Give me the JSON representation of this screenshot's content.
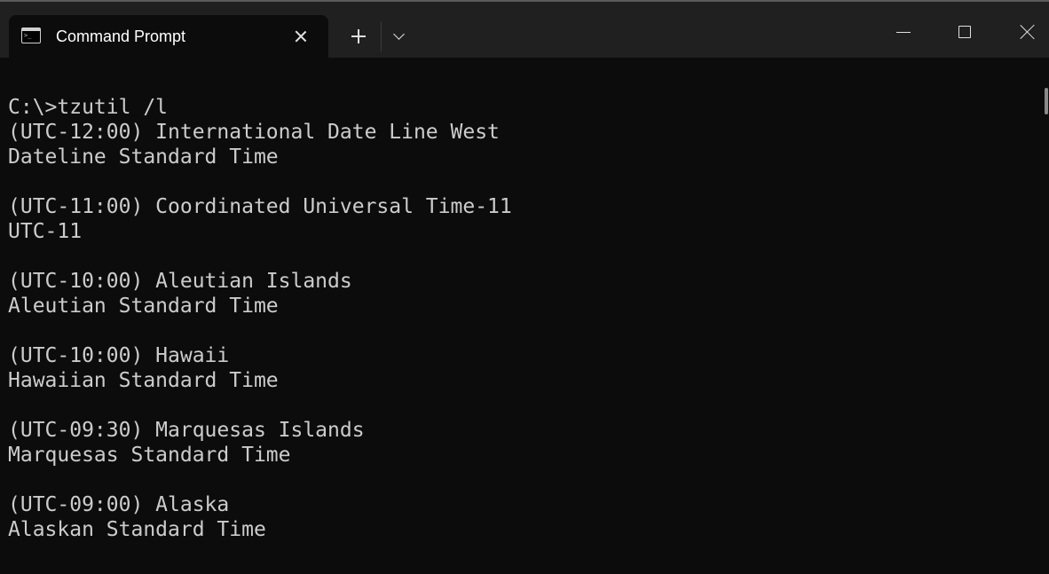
{
  "window": {
    "tab_title": "Command Prompt",
    "tab_icon": "terminal-icon",
    "tab_icon_glyph": ">_",
    "controls": {
      "close_tab": "close-icon",
      "new_tab": "plus-icon",
      "dropdown": "chevron-down-icon",
      "minimize": "minimize-icon",
      "maximize": "maximize-icon",
      "close_window": "close-icon"
    }
  },
  "terminal": {
    "lines": [
      "C:\\>tzutil /l",
      "(UTC-12:00) International Date Line West",
      "Dateline Standard Time",
      "",
      "(UTC-11:00) Coordinated Universal Time-11",
      "UTC-11",
      "",
      "(UTC-10:00) Aleutian Islands",
      "Aleutian Standard Time",
      "",
      "(UTC-10:00) Hawaii",
      "Hawaiian Standard Time",
      "",
      "(UTC-09:30) Marquesas Islands",
      "Marquesas Standard Time",
      "",
      "(UTC-09:00) Alaska",
      "Alaskan Standard Time"
    ]
  },
  "colors": {
    "background": "#0c0c0c",
    "titlebar": "#202020",
    "text": "#cccccc"
  }
}
